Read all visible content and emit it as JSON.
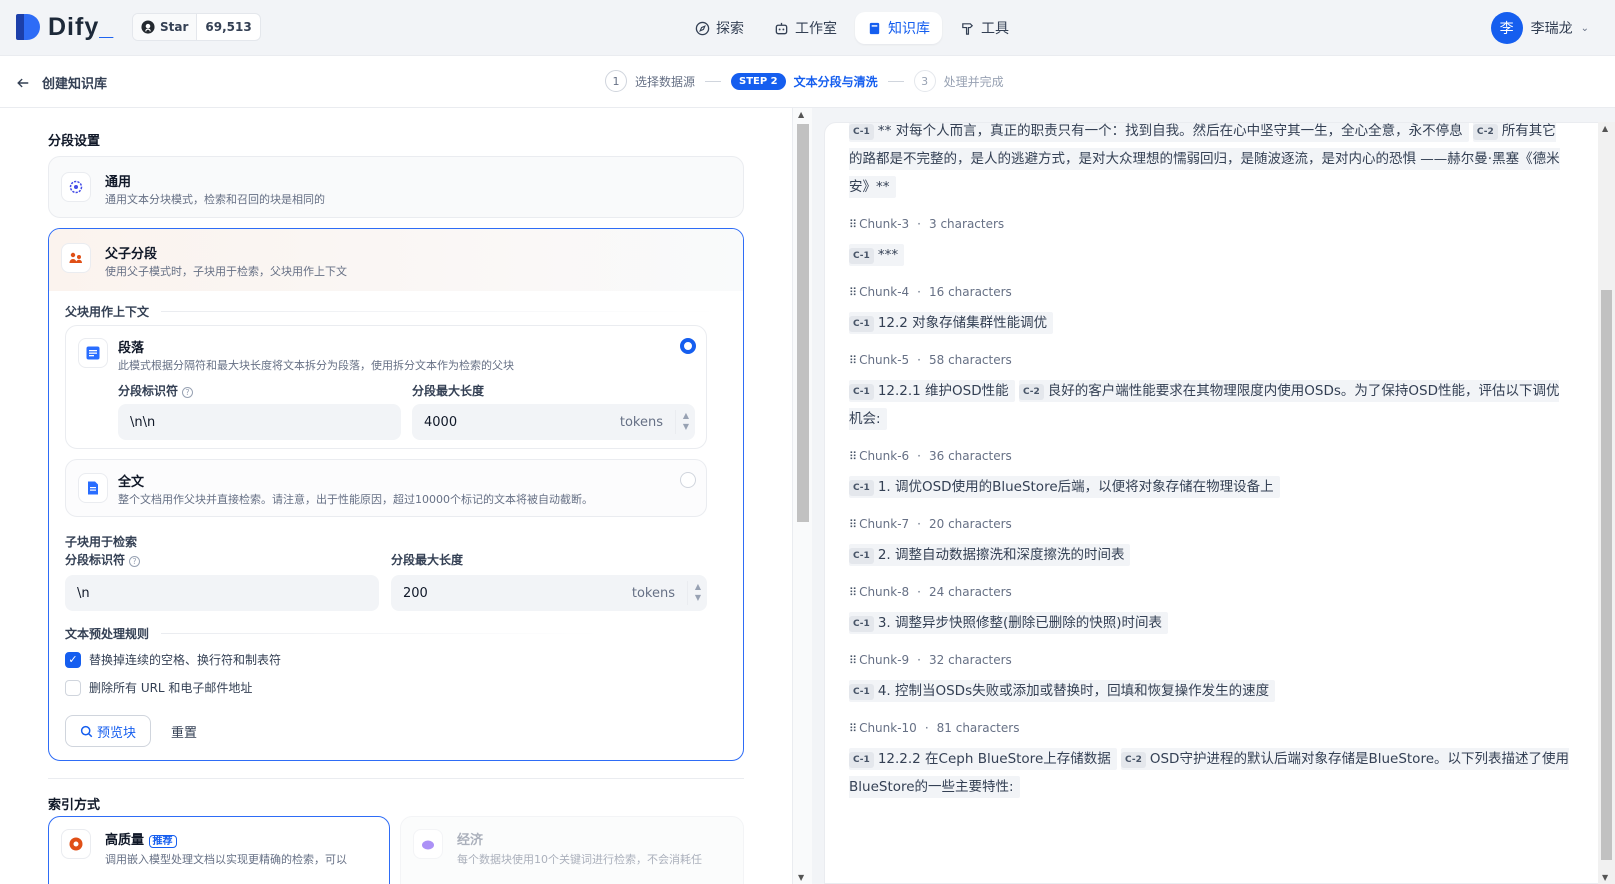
{
  "app": {
    "brand": "Dify",
    "star_label": "Star",
    "star_count": "69,513"
  },
  "nav": [
    {
      "label": "探索",
      "icon": "compass-icon"
    },
    {
      "label": "工作室",
      "icon": "robot-icon"
    },
    {
      "label": "知识库",
      "icon": "book-icon",
      "active": true
    },
    {
      "label": "工具",
      "icon": "hammer-icon"
    }
  ],
  "user": {
    "avatar": "李",
    "name": "李瑞龙"
  },
  "subbar": {
    "back_title": "创建知识库",
    "steps": [
      {
        "num": "1",
        "label": "选择数据源"
      },
      {
        "num": "STEP 2",
        "label": "文本分段与清洗"
      },
      {
        "num": "3",
        "label": "处理并完成"
      }
    ]
  },
  "segment_settings": {
    "title": "分段设置",
    "general": {
      "title": "通用",
      "desc": "通用文本分块模式，检索和召回的块是相同的"
    },
    "parent_child": {
      "title": "父子分段",
      "desc": "使用父子模式时，子块用于检索，父块用作上下文",
      "parent_label": "父块用作上下文",
      "paragraph": {
        "title": "段落",
        "desc": "此模式根据分隔符和最大块长度将文本拆分为段落，使用拆分文本作为检索的父块",
        "selected": true
      },
      "delimiter_label": "分段标识符",
      "delimiter_value": "\\n\\n",
      "maxlen_label": "分段最大长度",
      "maxlen_value": "4000",
      "unit": "tokens",
      "fulltext": {
        "title": "全文",
        "desc": "整个文档用作父块并直接检索。请注意，出于性能原因，超过10000个标记的文本将被自动截断。",
        "selected": false
      },
      "child_label": "子块用于检索",
      "child_delimiter_label": "分段标识符",
      "child_delimiter_value": "\\n",
      "child_maxlen_label": "分段最大长度",
      "child_maxlen_value": "200",
      "preprocess_label": "文本预处理规则",
      "rule1": {
        "label": "替换掉连续的空格、换行符和制表符",
        "checked": true
      },
      "rule2": {
        "label": "删除所有 URL 和电子邮件地址",
        "checked": false
      },
      "preview_btn": "预览块",
      "reset_btn": "重置"
    }
  },
  "index": {
    "title": "索引方式",
    "high": {
      "title": "高质量",
      "badge": "推荐",
      "desc": "调用嵌入模型处理文档以实现更精确的检索，可以"
    },
    "eco": {
      "title": "经济",
      "desc": "每个数据块使用10个关键词进行检索，不会消耗任"
    }
  },
  "preview": {
    "top_chunk": {
      "segs": [
        {
          "tag": "C-1",
          "text": "** 对每个人而言，真正的职责只有一个：找到自我。然后在心中坚守其一生，全心全意，永不停息"
        },
        {
          "tag": "C-2",
          "text": "所有其它的路都是不完整的，是人的逃避方式，是对大众理想的懦弱回归，是随波逐流，是对内心的恐惧 ——赫尔曼·黑塞《德米安》**"
        }
      ]
    },
    "chunks": [
      {
        "name": "Chunk-3",
        "chars": "3 characters",
        "segs": [
          {
            "tag": "C-1",
            "text": "***"
          }
        ]
      },
      {
        "name": "Chunk-4",
        "chars": "16 characters",
        "segs": [
          {
            "tag": "C-1",
            "text": "12.2 对象存储集群性能调优"
          }
        ]
      },
      {
        "name": "Chunk-5",
        "chars": "58 characters",
        "segs": [
          {
            "tag": "C-1",
            "text": "12.2.1 维护OSD性能"
          },
          {
            "tag": "C-2",
            "text": "良好的客户端性能要求在其物理限度内使用OSDs。为了保持OSD性能，评估以下调优机会:"
          }
        ]
      },
      {
        "name": "Chunk-6",
        "chars": "36 characters",
        "segs": [
          {
            "tag": "C-1",
            "text": "1. 调优OSD使用的BlueStore后端，以便将对象存储在物理设备上"
          }
        ]
      },
      {
        "name": "Chunk-7",
        "chars": "20 characters",
        "segs": [
          {
            "tag": "C-1",
            "text": "2. 调整自动数据擦洗和深度擦洗的时间表"
          }
        ]
      },
      {
        "name": "Chunk-8",
        "chars": "24 characters",
        "segs": [
          {
            "tag": "C-1",
            "text": "3. 调整异步快照修整(删除已删除的快照)时间表"
          }
        ]
      },
      {
        "name": "Chunk-9",
        "chars": "32 characters",
        "segs": [
          {
            "tag": "C-1",
            "text": "4. 控制当OSDs失败或添加或替换时，回填和恢复操作发生的速度"
          }
        ]
      },
      {
        "name": "Chunk-10",
        "chars": "81 characters",
        "segs": [
          {
            "tag": "C-1",
            "text": "12.2.2 在Ceph BlueStore上存储数据"
          },
          {
            "tag": "C-2",
            "text": "OSD守护进程的默认后端对象存储是BlueStore。以下列表描述了使用BlueStore的一些主要特性:"
          }
        ]
      }
    ]
  },
  "colors": {
    "accent": "#155eef",
    "border": "#eaecf0",
    "muted": "#667085"
  }
}
